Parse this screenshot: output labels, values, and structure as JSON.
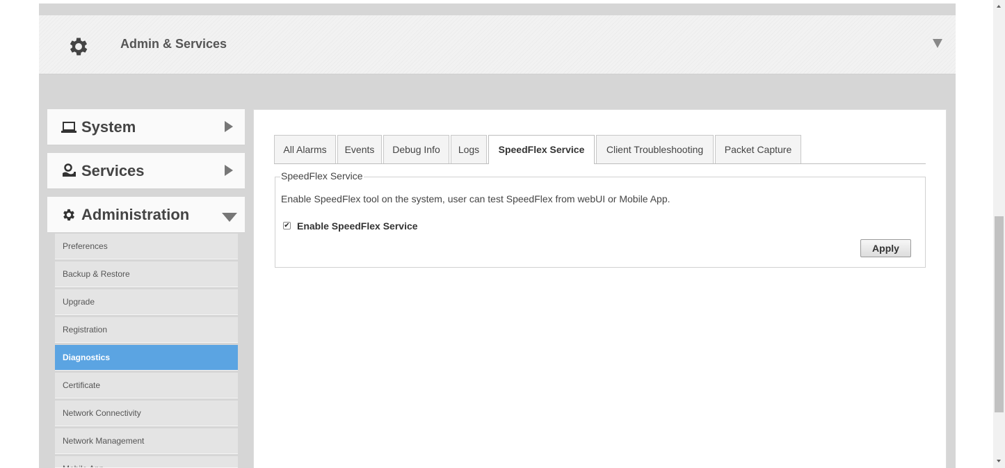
{
  "header": {
    "title": "Admin & Services",
    "icon": "gear-icon"
  },
  "sidebar": {
    "sections": [
      {
        "label": "System",
        "icon": "laptop-icon",
        "state": "collapsed"
      },
      {
        "label": "Services",
        "icon": "services-icon",
        "state": "collapsed"
      },
      {
        "label": "Administration",
        "icon": "gear-icon",
        "state": "expanded"
      }
    ],
    "items": [
      {
        "label": "Preferences"
      },
      {
        "label": "Backup & Restore"
      },
      {
        "label": "Upgrade"
      },
      {
        "label": "Registration"
      },
      {
        "label": "Diagnostics",
        "active": true
      },
      {
        "label": "Certificate"
      },
      {
        "label": "Network Connectivity"
      },
      {
        "label": "Network Management"
      },
      {
        "label": "Mobile App"
      }
    ]
  },
  "tabs": [
    {
      "label": "All Alarms"
    },
    {
      "label": "Events"
    },
    {
      "label": "Debug Info"
    },
    {
      "label": "Logs"
    },
    {
      "label": "SpeedFlex Service",
      "active": true
    },
    {
      "label": "Client Troubleshooting"
    },
    {
      "label": "Packet Capture"
    }
  ],
  "panel": {
    "legend": "SpeedFlex Service",
    "description": "Enable SpeedFlex tool on the system, user can test SpeedFlex from webUI or Mobile App.",
    "checkbox_label": "Enable SpeedFlex Service",
    "checkbox_checked": true,
    "check_mark": "✔",
    "apply_label": "Apply"
  },
  "colors": {
    "active_item": "#5ba4e2"
  }
}
